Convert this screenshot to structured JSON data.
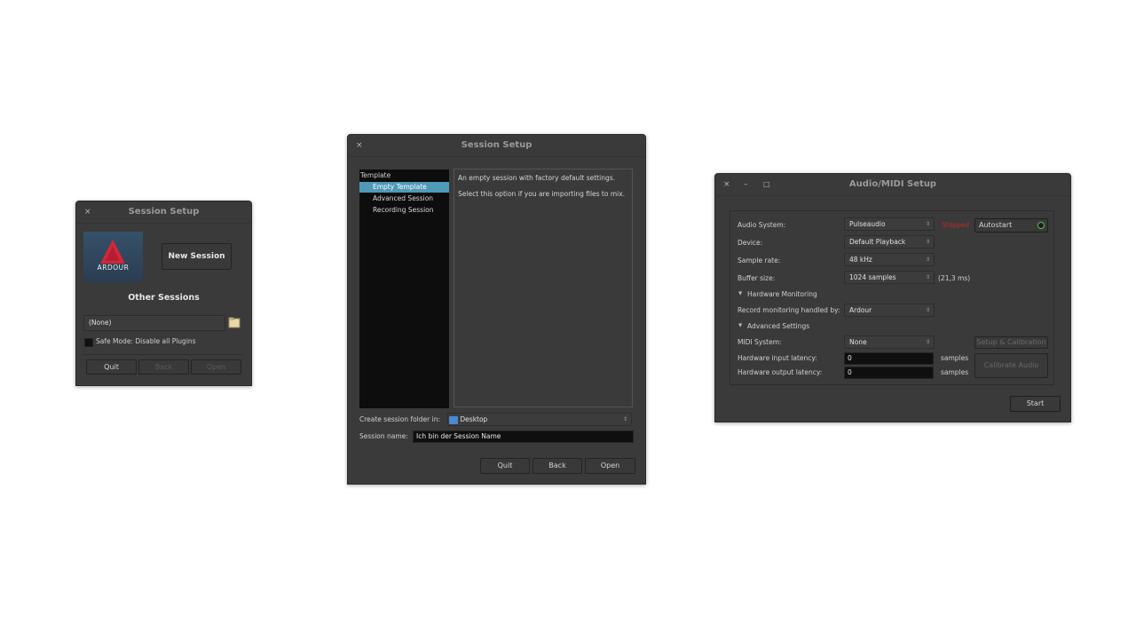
{
  "win1": {
    "title": "Session Setup",
    "close_glyph": "×",
    "logo_text": "ARDOUR",
    "new_session_label": "New Session",
    "other_sessions_label": "Other Sessions",
    "recent_combo_value": "(None)",
    "safe_mode_label": "Safe Mode: Disable all Plugins",
    "quit_label": "Quit",
    "back_label": "Back",
    "open_label": "Open"
  },
  "win2": {
    "title": "Session Setup",
    "close_glyph": "×",
    "template_header": "Template",
    "templates": [
      {
        "label": "Empty Template",
        "selected": true
      },
      {
        "label": "Advanced Session",
        "selected": false
      },
      {
        "label": "Recording Session",
        "selected": false
      }
    ],
    "description_line1": "An empty session with factory default settings.",
    "description_line2": "Select this option if you are importing files to mix.",
    "folder_label": "Create session folder in:",
    "folder_value": "Desktop",
    "name_label": "Session name:",
    "name_value": "Ich bin der Session Name",
    "quit_label": "Quit",
    "back_label": "Back",
    "open_label": "Open",
    "accent_color": "#4e9ab8"
  },
  "win3": {
    "title": "Audio/MIDI Setup",
    "close_glyph": "×",
    "minimize_glyph": "–",
    "maximize_glyph": "□",
    "audio_system_label": "Audio System:",
    "audio_system_value": "Pulseaudio",
    "status_text": "Stopped",
    "status_color": "#c0282b",
    "autostart_label": "Autostart",
    "device_label": "Device:",
    "device_value": "Default Playback",
    "sample_rate_label": "Sample rate:",
    "sample_rate_value": "48 kHz",
    "buffer_size_label": "Buffer size:",
    "buffer_size_value": "1024 samples",
    "buffer_latency_text": "(21,3 ms)",
    "hw_monitoring_label": "Hardware Monitoring",
    "record_monitoring_label": "Record monitoring handled by:",
    "record_monitoring_value": "Ardour",
    "advanced_settings_label": "Advanced Settings",
    "midi_system_label": "MIDI System:",
    "midi_system_value": "None",
    "setup_calibration_label": "Setup & Calibration",
    "hw_input_latency_label": "Hardware input latency:",
    "hw_input_latency_value": "0",
    "hw_output_latency_label": "Hardware output latency:",
    "hw_output_latency_value": "0",
    "samples_unit": "samples",
    "calibrate_audio_label": "Calibrate Audio",
    "start_label": "Start"
  },
  "icons": {
    "combo_arrow": "⇕",
    "expander": "▼",
    "folder_icon": "folder-icon",
    "desktop_icon": "desktop-icon"
  }
}
